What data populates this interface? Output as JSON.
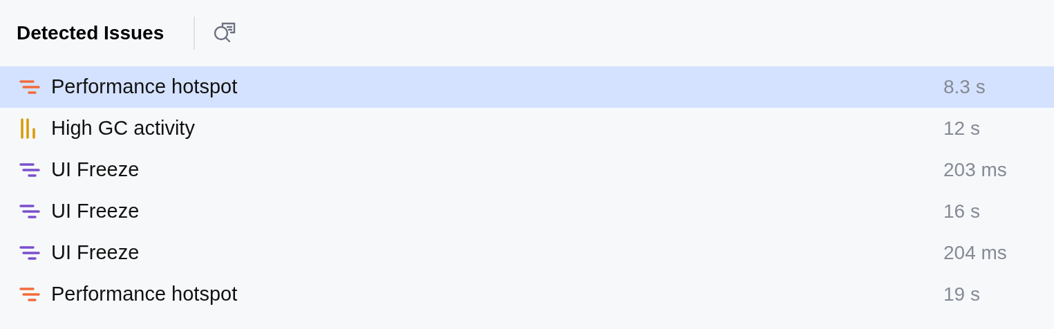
{
  "panel": {
    "title": "Detected Issues"
  },
  "issues": [
    {
      "label": "Performance hotspot",
      "duration": "8.3 s",
      "kind": "lines",
      "color": "#f26b3a",
      "selected": true
    },
    {
      "label": "High GC activity",
      "duration": "12 s",
      "kind": "bars",
      "color": "#d99a06",
      "selected": false
    },
    {
      "label": "UI Freeze",
      "duration": "203 ms",
      "kind": "lines",
      "color": "#7a4fcc",
      "selected": false
    },
    {
      "label": "UI Freeze",
      "duration": "16 s",
      "kind": "lines",
      "color": "#7a4fcc",
      "selected": false
    },
    {
      "label": "UI Freeze",
      "duration": "204 ms",
      "kind": "lines",
      "color": "#7a4fcc",
      "selected": false
    },
    {
      "label": "Performance hotspot",
      "duration": "19 s",
      "kind": "lines",
      "color": "#f26b3a",
      "selected": false
    }
  ]
}
